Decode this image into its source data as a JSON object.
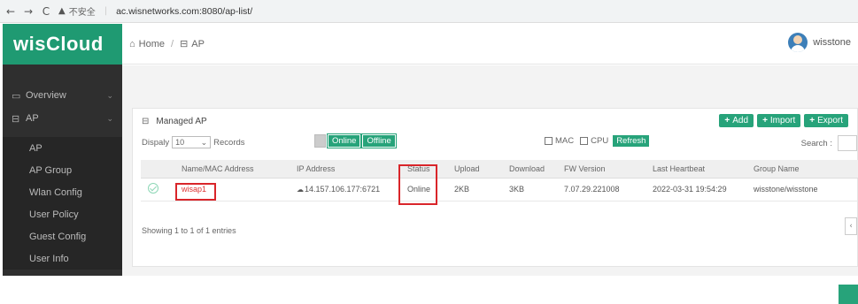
{
  "browser": {
    "back": "←",
    "forward": "→",
    "reload": "C",
    "insecure_label": "不安全",
    "url": "ac.wisnetworks.com:8080/ap-list/"
  },
  "brand": "wisCloud",
  "sidebar": {
    "items": [
      {
        "label": "Overview",
        "icon": "monitor-icon"
      },
      {
        "label": "AP",
        "icon": "ap-icon"
      }
    ],
    "sub_items": [
      "AP",
      "AP Group",
      "Wlan Config",
      "User Policy",
      "Guest Config",
      "User Info"
    ]
  },
  "header": {
    "home": "Home",
    "separator": "/",
    "current": "AP",
    "username": "wisstone"
  },
  "panel": {
    "title": "Managed AP",
    "buttons": {
      "add": "Add",
      "import": "Import",
      "export": "Export"
    },
    "display_label": "Dispaly",
    "display_value": "10",
    "records_label": "Records",
    "filter_online": "Online",
    "filter_offline": "Offline",
    "col_mac": "MAC",
    "col_cpu": "CPU",
    "refresh": "Refresh",
    "search_label": "Search :"
  },
  "table": {
    "columns": [
      "Name/MAC Address",
      "IP Address",
      "Status",
      "Upload",
      "Download",
      "FW Version",
      "Last Heartbeat",
      "Group Name"
    ],
    "rows": [
      {
        "name": "wisap1",
        "ip": "14.157.106.177:6721",
        "status": "Online",
        "upload": "2KB",
        "download": "3KB",
        "fw": "7.07.29.221008",
        "heartbeat": "2022-03-31 19:54:29",
        "group": "wisstone/wisstone"
      }
    ]
  },
  "footer": {
    "entries": "Showing 1 to 1 of 1 entries",
    "prev": "‹"
  },
  "colors": {
    "accent": "#27a37a",
    "sidebar": "#2f2f2f",
    "highlight": "#d9252a"
  }
}
